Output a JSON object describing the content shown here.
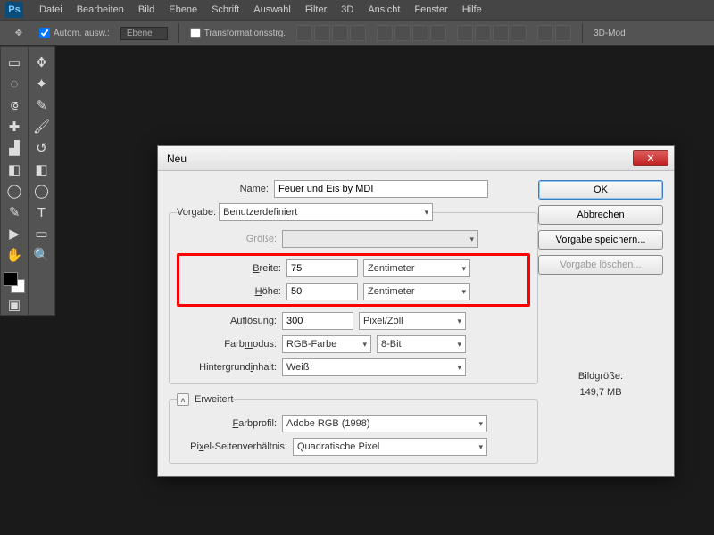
{
  "app": {
    "logo": "Ps"
  },
  "menu": [
    "Datei",
    "Bearbeiten",
    "Bild",
    "Ebene",
    "Schrift",
    "Auswahl",
    "Filter",
    "3D",
    "Ansicht",
    "Fenster",
    "Hilfe"
  ],
  "options": {
    "auto_select": "Autom. ausw.:",
    "layer_select": "Ebene",
    "transform_ctrl": "Transformationsstrg.",
    "three_d": "3D-Mod"
  },
  "dialog": {
    "title": "Neu",
    "name_label": "Name:",
    "name_value": "Feuer und Eis by MDI",
    "preset_label": "Vorgabe:",
    "preset_value": "Benutzerdefiniert",
    "size_label": "Größe:",
    "width_label": "Breite:",
    "width_value": "75",
    "width_unit": "Zentimeter",
    "height_label": "Höhe:",
    "height_value": "50",
    "height_unit": "Zentimeter",
    "res_label": "Auflösung:",
    "res_value": "300",
    "res_unit": "Pixel/Zoll",
    "mode_label": "Farbmodus:",
    "mode_value": "RGB-Farbe",
    "depth_value": "8-Bit",
    "bg_label": "Hintergrundinhalt:",
    "bg_value": "Weiß",
    "advanced": "Erweitert",
    "profile_label": "Farbprofil:",
    "profile_value": "Adobe RGB (1998)",
    "aspect_label": "Pixel-Seitenverhältnis:",
    "aspect_value": "Quadratische Pixel",
    "ok": "OK",
    "cancel": "Abbrechen",
    "save_preset": "Vorgabe speichern...",
    "delete_preset": "Vorgabe löschen...",
    "filesize_label": "Bildgröße:",
    "filesize_value": "149,7 MB"
  }
}
